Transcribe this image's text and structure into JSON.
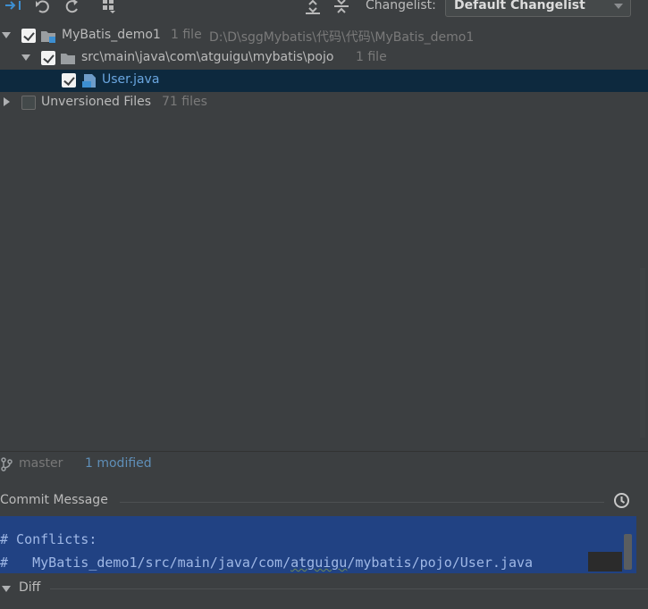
{
  "toolbar": {
    "changelist_label": "Changelist:",
    "changelist_value": "Default Changelist",
    "icons": [
      "compare-arrows-icon",
      "rollback-icon",
      "refresh-icon",
      "group-by-icon",
      "expand-all-icon",
      "collapse-all-icon"
    ]
  },
  "tree": {
    "rows": [
      {
        "name": "MyBatis_demo1",
        "count": "1 file",
        "path": "D:\\D\\sggMybatis\\代码\\代码\\MyBatis_demo1",
        "checked": true,
        "expanded": true
      },
      {
        "name": "src\\main\\java\\com\\atguigu\\mybatis\\pojo",
        "count": "1 file",
        "checked": true,
        "expanded": true
      },
      {
        "name": "User.java",
        "checked": true,
        "selected": true
      },
      {
        "name": "Unversioned Files",
        "count": "71 files",
        "checked": false,
        "expanded": false
      }
    ]
  },
  "status": {
    "branch": "master",
    "modified": "1 modified"
  },
  "commit": {
    "header": "Commit Message",
    "line1": "# Conflicts:",
    "line2_prefix": "#   MyBatis_demo1/src/main/java/com/",
    "line2_word": "atguigu",
    "line2_suffix": "/mybatis/pojo/User.java"
  },
  "diff": {
    "label": "Diff"
  },
  "colors": {
    "background": "#3c3f41",
    "selection": "#0d293e",
    "editor_selection": "#214283",
    "accent_blue": "#6aa6e0"
  }
}
